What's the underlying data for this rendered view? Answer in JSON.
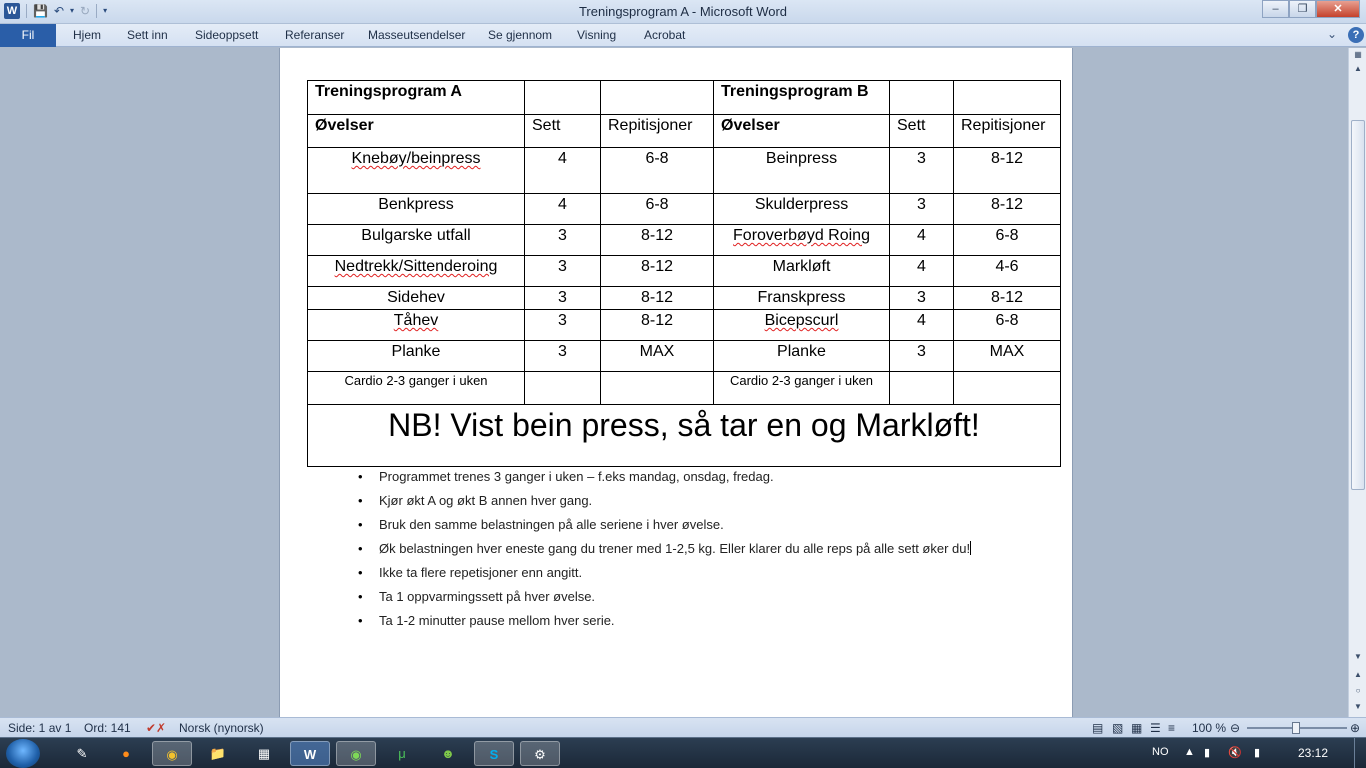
{
  "window": {
    "title": "Treningsprogram A  -  Microsoft Word"
  },
  "ribbon": {
    "file_tab": "Fil",
    "tabs": [
      "Hjem",
      "Sett inn",
      "Sideoppsett",
      "Referanser",
      "Masseutsendelser",
      "Se gjennom",
      "Visning",
      "Acrobat"
    ]
  },
  "table": {
    "program_a": "Treningsprogram A",
    "program_b": "Treningsprogram B",
    "headers": {
      "ovelser": "Øvelser",
      "sett": "Sett",
      "rep": "Repitisjoner"
    },
    "rows": [
      {
        "a": "Knebøy/beinpress",
        "as": "4",
        "ar": "6-8",
        "b": "Beinpress",
        "bs": "3",
        "br": "8-12"
      },
      {
        "a": "Benkpress",
        "as": "4",
        "ar": "6-8",
        "b": "Skulderpress",
        "bs": "3",
        "br": "8-12"
      },
      {
        "a": "Bulgarske utfall",
        "as": "3",
        "ar": "8-12",
        "b": "Foroverbøyd Roing",
        "bs": "4",
        "br": "6-8"
      },
      {
        "a": "Nedtrekk/Sittenderoing",
        "as": "3",
        "ar": "8-12",
        "b": "Markløft",
        "bs": "4",
        "br": "4-6"
      },
      {
        "a": "Sidehev",
        "as": "3",
        "ar": "8-12",
        "b": "Franskpress",
        "bs": "3",
        "br": "8-12"
      },
      {
        "a": "Tåhev",
        "as": "3",
        "ar": "8-12",
        "b": "Bicepscurl",
        "bs": "4",
        "br": "6-8"
      },
      {
        "a": "Planke",
        "as": "3",
        "ar": "MAX",
        "b": "Planke",
        "bs": "3",
        "br": "MAX"
      }
    ],
    "cardio_a": "Cardio 2-3 ganger i uken",
    "cardio_b": "Cardio 2-3 ganger i uken",
    "nb": "NB! Vist bein press, så tar en og Markløft!"
  },
  "notes": [
    "Programmet trenes 3 ganger i uken – f.eks mandag,  onsdag, fredag.",
    "Kjør økt A og økt B annen hver gang.",
    "Bruk den samme  belastningen på alle seriene i hver øvelse.",
    "Øk belastningen hver eneste gang du trener med 1-2,5 kg. Eller klarer du alle reps på alle sett øker du!",
    "Ikke ta flere repetisjoner enn angitt.",
    "Ta 1 oppvarmingssett på hver øvelse.",
    "Ta 1-2 minutter pause mellom hver serie."
  ],
  "status": {
    "page": "Side: 1 av 1",
    "words": "Ord: 141",
    "language": "Norsk (nynorsk)",
    "zoom": "100 %",
    "zoom_level": 1.0
  },
  "taskbar": {
    "lang": "NO",
    "time": "23:12",
    "apps": [
      "pen-tool",
      "firefox",
      "chrome",
      "explorer",
      "calculator",
      "word",
      "spotify",
      "utorrent",
      "messenger",
      "skype",
      "steam"
    ]
  }
}
